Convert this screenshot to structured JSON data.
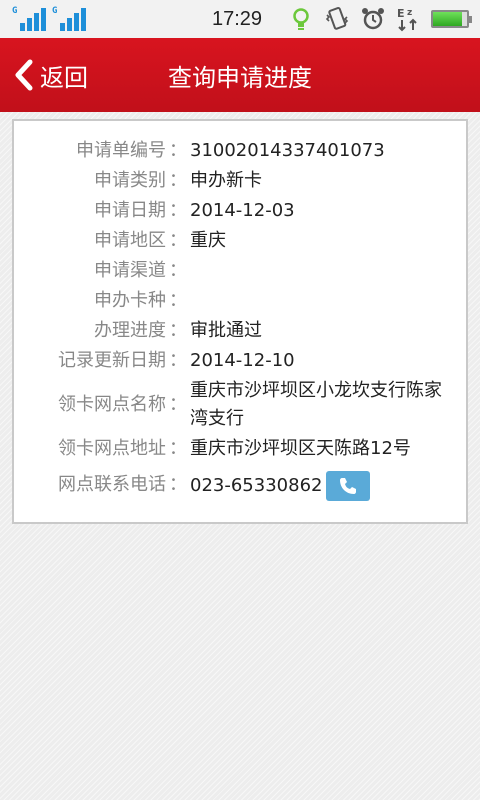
{
  "status_bar": {
    "time": "17:29",
    "sim1_tag": "G",
    "sim2_tag": "G",
    "icons": [
      "signal-sim1-icon",
      "signal-sim2-icon",
      "lightbulb-icon",
      "vibrate-icon",
      "alarm-clock-icon",
      "sync-icon",
      "battery-icon"
    ],
    "battery_level": 0.85,
    "accent_color": "#1e8fd9"
  },
  "header": {
    "back_label": "返回",
    "title": "查询申请进度",
    "background_color": "#c1101a"
  },
  "details": {
    "rows": [
      {
        "label": "申请单编号",
        "colon": "：",
        "value": "31002014337401073"
      },
      {
        "label": "申请类别",
        "colon": "：",
        "value": "申办新卡"
      },
      {
        "label": "申请日期",
        "colon": "：",
        "value": "2014-12-03"
      },
      {
        "label": "申请地区",
        "colon": "：",
        "value": "重庆"
      },
      {
        "label": "申请渠道",
        "colon": "：",
        "value": ""
      },
      {
        "label": "申办卡种",
        "colon": "：",
        "value": ""
      },
      {
        "label": "办理进度",
        "colon": "：",
        "value": "审批通过"
      },
      {
        "label": "记录更新日期",
        "colon": "：",
        "value": "2014-12-10"
      },
      {
        "label": "领卡网点名称",
        "colon": "：",
        "value": "重庆市沙坪坝区小龙坎支行陈家湾支行"
      },
      {
        "label": "领卡网点地址",
        "colon": "：",
        "value": "重庆市沙坪坝区天陈路12号"
      },
      {
        "label": "网点联系电话",
        "colon": "：",
        "value": "023-65330862"
      }
    ],
    "phone_button_icon": "phone-icon",
    "phone_button_color": "#5aaad8"
  }
}
